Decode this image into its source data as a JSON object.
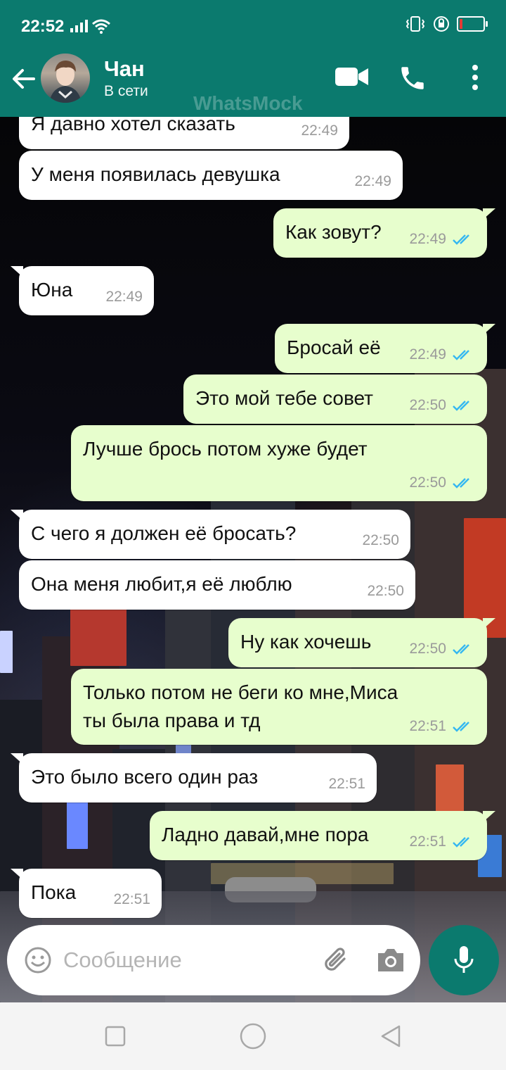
{
  "status_bar": {
    "time": "22:52"
  },
  "header": {
    "contact_name": "Чан",
    "contact_status": "В сети",
    "watermark": "WhatsMock",
    "icons": [
      "back-arrow-icon",
      "video-call-icon",
      "phone-icon",
      "more-vert-icon"
    ]
  },
  "messages": [
    {
      "dir": "in",
      "text": "Я давно хотел сказать",
      "time": "22:49"
    },
    {
      "dir": "in",
      "text": "У меня появилась девушка",
      "time": "22:49"
    },
    {
      "dir": "out",
      "text": "Как зовут?",
      "time": "22:49",
      "read": true
    },
    {
      "dir": "in",
      "text": "Юна",
      "time": "22:49"
    },
    {
      "dir": "out",
      "text": "Бросай её",
      "time": "22:49",
      "read": true
    },
    {
      "dir": "out",
      "text": "Это мой тебе совет",
      "time": "22:50",
      "read": true
    },
    {
      "dir": "out",
      "text": "Лучше брось потом хуже будет",
      "time": "22:50",
      "read": true
    },
    {
      "dir": "in",
      "text": "С чего я должен её бросать?",
      "time": "22:50"
    },
    {
      "dir": "in",
      "text": "Она меня любит,я её люблю",
      "time": "22:50"
    },
    {
      "dir": "out",
      "text": "Ну как хочешь",
      "time": "22:50",
      "read": true
    },
    {
      "dir": "out",
      "text_line1": "Только потом не беги ко мне,Миса",
      "text_line2": "ты была права и тд",
      "time": "22:51",
      "read": true
    },
    {
      "dir": "in",
      "text": "Это было всего один раз",
      "time": "22:51"
    },
    {
      "dir": "out",
      "text": "Ладно давай,мне пора",
      "time": "22:51",
      "read": true
    },
    {
      "dir": "in",
      "text": "Пока",
      "time": "22:51"
    }
  ],
  "composer": {
    "placeholder": "Сообщение",
    "icons": [
      "emoji-icon",
      "attach-icon",
      "camera-icon",
      "mic-icon"
    ]
  },
  "colors": {
    "header": "#0b7a6e",
    "outgoing_bubble": "#e7fecd",
    "incoming_bubble": "#ffffff",
    "read_ticks": "#34b7f1"
  }
}
